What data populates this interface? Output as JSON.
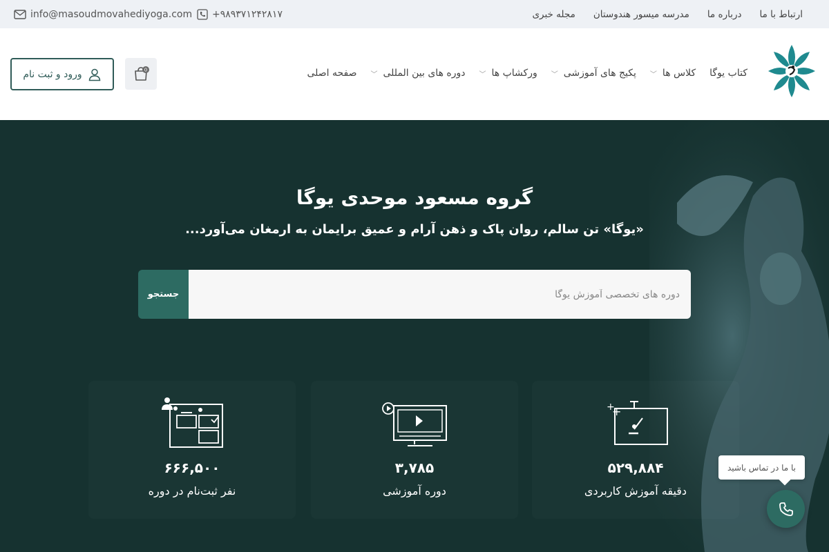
{
  "topbar": {
    "email": "info@masoudmovahediyoga.com",
    "phone": "+۹۸۹۳۷۱۲۴۲۸۱۷",
    "links": [
      "مجله خبری",
      "مدرسه میسور هندوستان",
      "درباره ما",
      "ارتباط با ما"
    ]
  },
  "header": {
    "nav": [
      {
        "label": "صفحه اصلی",
        "has_menu": false
      },
      {
        "label": "دوره های بین المللی",
        "has_menu": true
      },
      {
        "label": "ورکشاپ ها",
        "has_menu": true
      },
      {
        "label": "پکیج های آموزشی",
        "has_menu": true
      },
      {
        "label": "کلاس ها",
        "has_menu": true
      },
      {
        "label": "کتاب یوگا",
        "has_menu": false
      }
    ],
    "cart_count": "0",
    "login_label": "ورود و ثبت نام"
  },
  "hero": {
    "title": "گروه مسعود موحدی یوگا",
    "subtitle": "«یوگا» تن سالم، روان پاک و ذهن آرام و عمیق برایمان به ارمغان می‌آورد...",
    "search_placeholder": "دوره های تخصصی آموزش یوگا",
    "search_button": "جستجو"
  },
  "stats": [
    {
      "number": "۵۲۹,۸۸۴",
      "label": "دقیقه آموزش کاربردی",
      "icon": "stopwatch-icon"
    },
    {
      "number": "۳,۷۸۵",
      "label": "دوره آموزشی",
      "icon": "video-monitor-icon"
    },
    {
      "number": "۶۶۶,۵۰۰",
      "label": "نفر ثبت‌نام در دوره",
      "icon": "users-board-icon"
    }
  ],
  "contact": {
    "tooltip": "با ما در تماس باشید"
  },
  "colors": {
    "hero_bg": "#163230",
    "accent": "#2d6b62",
    "login_border": "#2f5b57"
  }
}
